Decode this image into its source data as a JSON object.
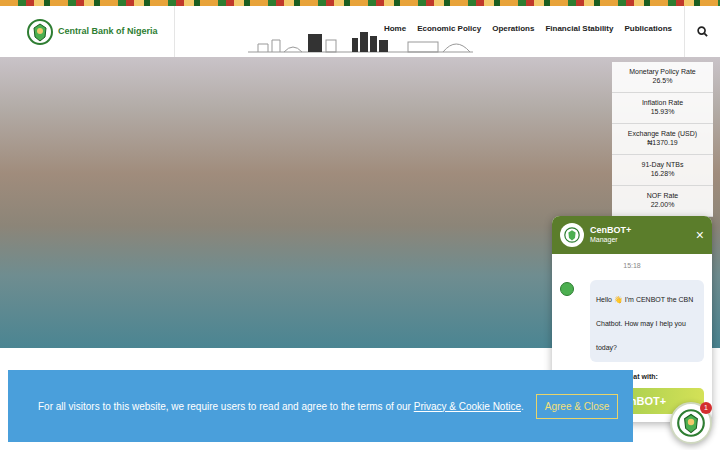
{
  "header": {
    "logo_text": "Central Bank of Nigeria",
    "nav": [
      "Home",
      "Economic Policy",
      "Operations",
      "Financial Stability",
      "Publications"
    ]
  },
  "rates": [
    {
      "label": "Monetary Policy Rate",
      "value": "26.5%"
    },
    {
      "label": "Inflation Rate",
      "value": "15.93%"
    },
    {
      "label": "Exchange Rate (USD)",
      "value": "₦1370.19"
    },
    {
      "label": "91-Day NTBs",
      "value": "16.28%"
    },
    {
      "label": "NOF Rate",
      "value": "22.00%"
    }
  ],
  "chat": {
    "title": "CenBOT+",
    "subtitle": "Manager",
    "close": "×",
    "time": "15:18",
    "message": "Hello 👋 I'm CENBOT the CBN Chatbot. How may I help you today?",
    "start_label": "Start Chat with:",
    "start_button": "CenBOT+"
  },
  "cookie": {
    "text": "For all visitors to this website, we require users to read and agree to the terms of our ",
    "link": "Privacy & Cookie Notice",
    "after": ".",
    "button": "Agree & Close"
  },
  "launcher": {
    "badge": "1"
  }
}
